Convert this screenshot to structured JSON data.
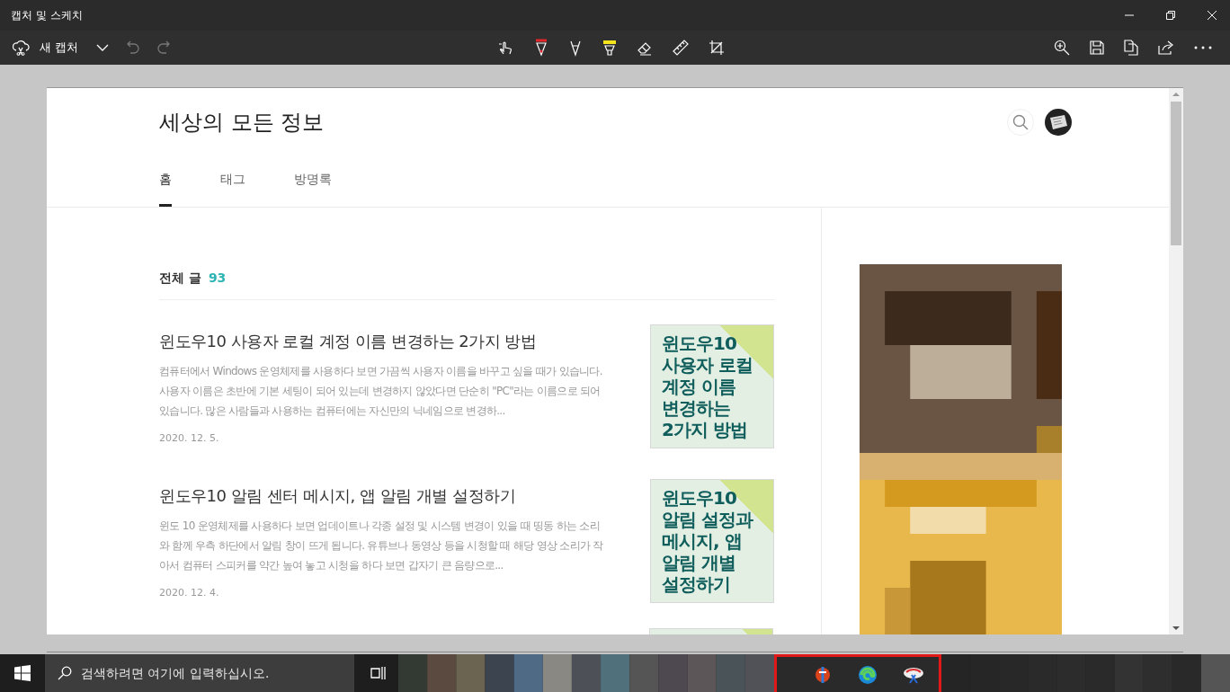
{
  "window": {
    "title": "캡처 및 스케치"
  },
  "toolbar": {
    "new_capture": "새 캡처"
  },
  "page": {
    "blog_title": "세상의 모든 정보",
    "tabs": [
      {
        "label": "홈",
        "selected": true
      },
      {
        "label": "태그",
        "selected": false
      },
      {
        "label": "방명록",
        "selected": false
      }
    ],
    "list_header": {
      "label": "전체 글",
      "count": "93"
    },
    "posts": [
      {
        "title": "윈도우10 사용자 로컬 계정 이름 변경하는 2가지 방법",
        "excerpt": "컴퓨터에서 Windows 운영체제를 사용하다 보면 가끔씩 사용자 이름을 바꾸고 싶을 때가 있습니다. 사용자 이름은 초반에 기본 세팅이 되어 있는데 변경하지 않았다면 단순히 \"PC\"라는 이름으로 되어 있습니다. 많은 사람들과 사용하는 컴퓨터에는 자신만의 닉네임으로 변경하...",
        "date": "2020. 12. 5.",
        "thumbnail_lines": [
          "윈도우10",
          "사용자 로컬",
          "계정 이름",
          "변경하는",
          "2가지 방법"
        ]
      },
      {
        "title": "윈도우10 알림 센터 메시지, 앱 알림 개별 설정하기",
        "excerpt": "윈도 10 운영체제를 사용하다 보면 업데이트나 각종 설정 및 시스템 변경이 있을 때 띵동 하는 소리와 함께 우측 하단에서 알림 창이 뜨게 됩니다. 유튜브나 동영상 등을 시청할 때 해당 영상 소리가 작아서 컴퓨터 스피커를 약간 높여 놓고 시청을 하다 보면 갑자기 큰 음량으로...",
        "date": "2020. 12. 4.",
        "thumbnail_lines": [
          "윈도우10",
          "알림 설정과",
          "메시지, 앱",
          "알림 개별",
          "설정하기"
        ]
      }
    ]
  },
  "taskbar": {
    "search": {
      "placeholder": "검색하려면 여기에 입력하십시오."
    }
  }
}
